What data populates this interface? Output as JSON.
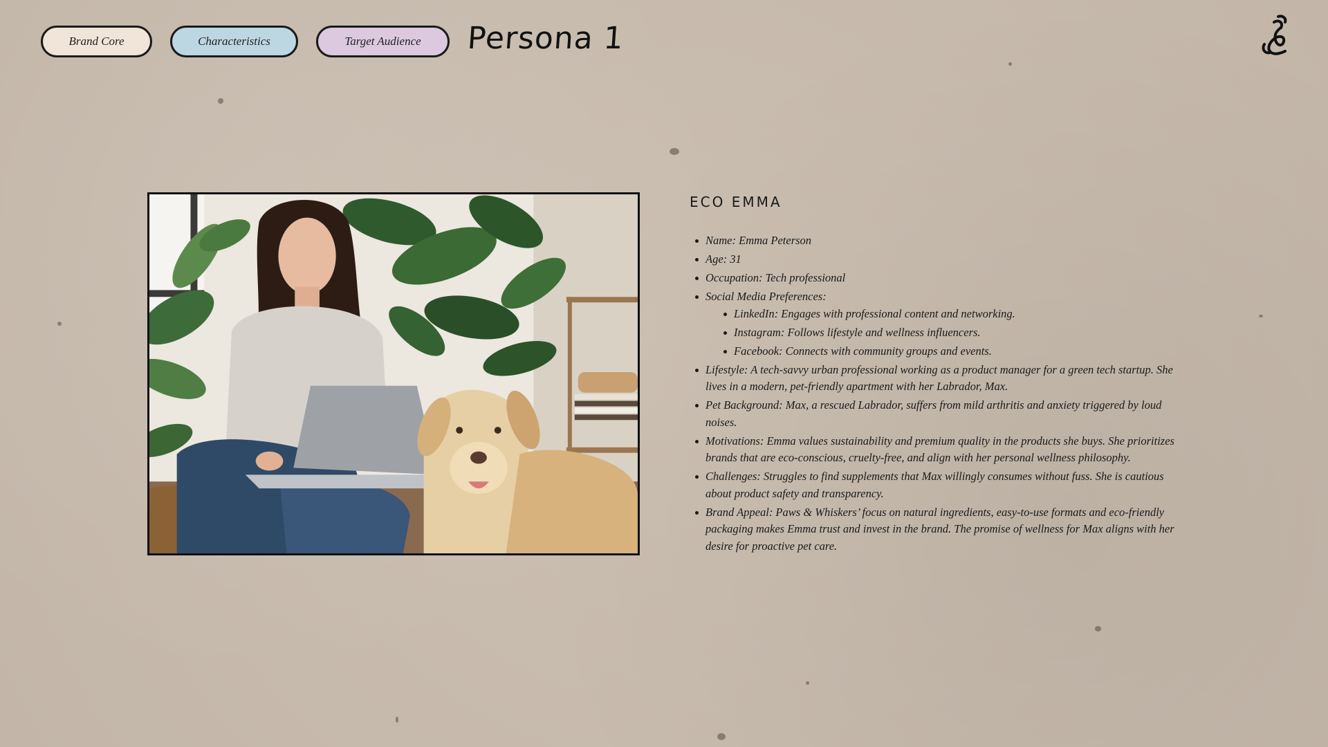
{
  "nav": {
    "brand_core": "Brand Core",
    "characteristics": "Characteristics",
    "target_audience": "Target Audience"
  },
  "page_title": "Persona 1",
  "logo_icon": "squiggle-logo-icon",
  "photo_alt": "Woman with laptop and Labrador dog among plants",
  "persona": {
    "heading": "ECO EMMA",
    "name": "Name: Emma Peterson",
    "age": "Age: 31",
    "occupation": "Occupation: Tech professional",
    "social_media": "Social Media Preferences:",
    "social": [
      "LinkedIn: Engages with professional content and networking.",
      "Instagram: Follows lifestyle and wellness influencers.",
      "Facebook: Connects with community groups and events."
    ],
    "lifestyle": "Lifestyle: A tech-savvy urban professional working as a product manager for a green tech startup. She lives in a modern, pet-friendly apartment with her Labrador, Max.",
    "pet_background": "Pet Background: Max, a rescued Labrador, suffers from mild arthritis and anxiety triggered by loud noises.",
    "motivations": "Motivations: Emma values sustainability and premium quality in the products she buys. She prioritizes brands that are eco-conscious, cruelty-free, and align with her personal wellness philosophy.",
    "challenges": "Challenges: Struggles to find supplements that Max willingly consumes without fuss. She is cautious about product safety and transparency.",
    "brand_appeal": "Brand Appeal: Paws & Whiskers’ focus on natural ingredients, easy-to-use formats and eco-friendly packaging makes Emma trust and invest in the brand. The promise of wellness for Max aligns with her desire for proactive pet care."
  },
  "colors": {
    "background": "#c9bcae",
    "pill_brand_core": "#f1e4d8",
    "pill_characteristics": "#bcd7e2",
    "pill_target_audience": "#dcc9e0"
  }
}
